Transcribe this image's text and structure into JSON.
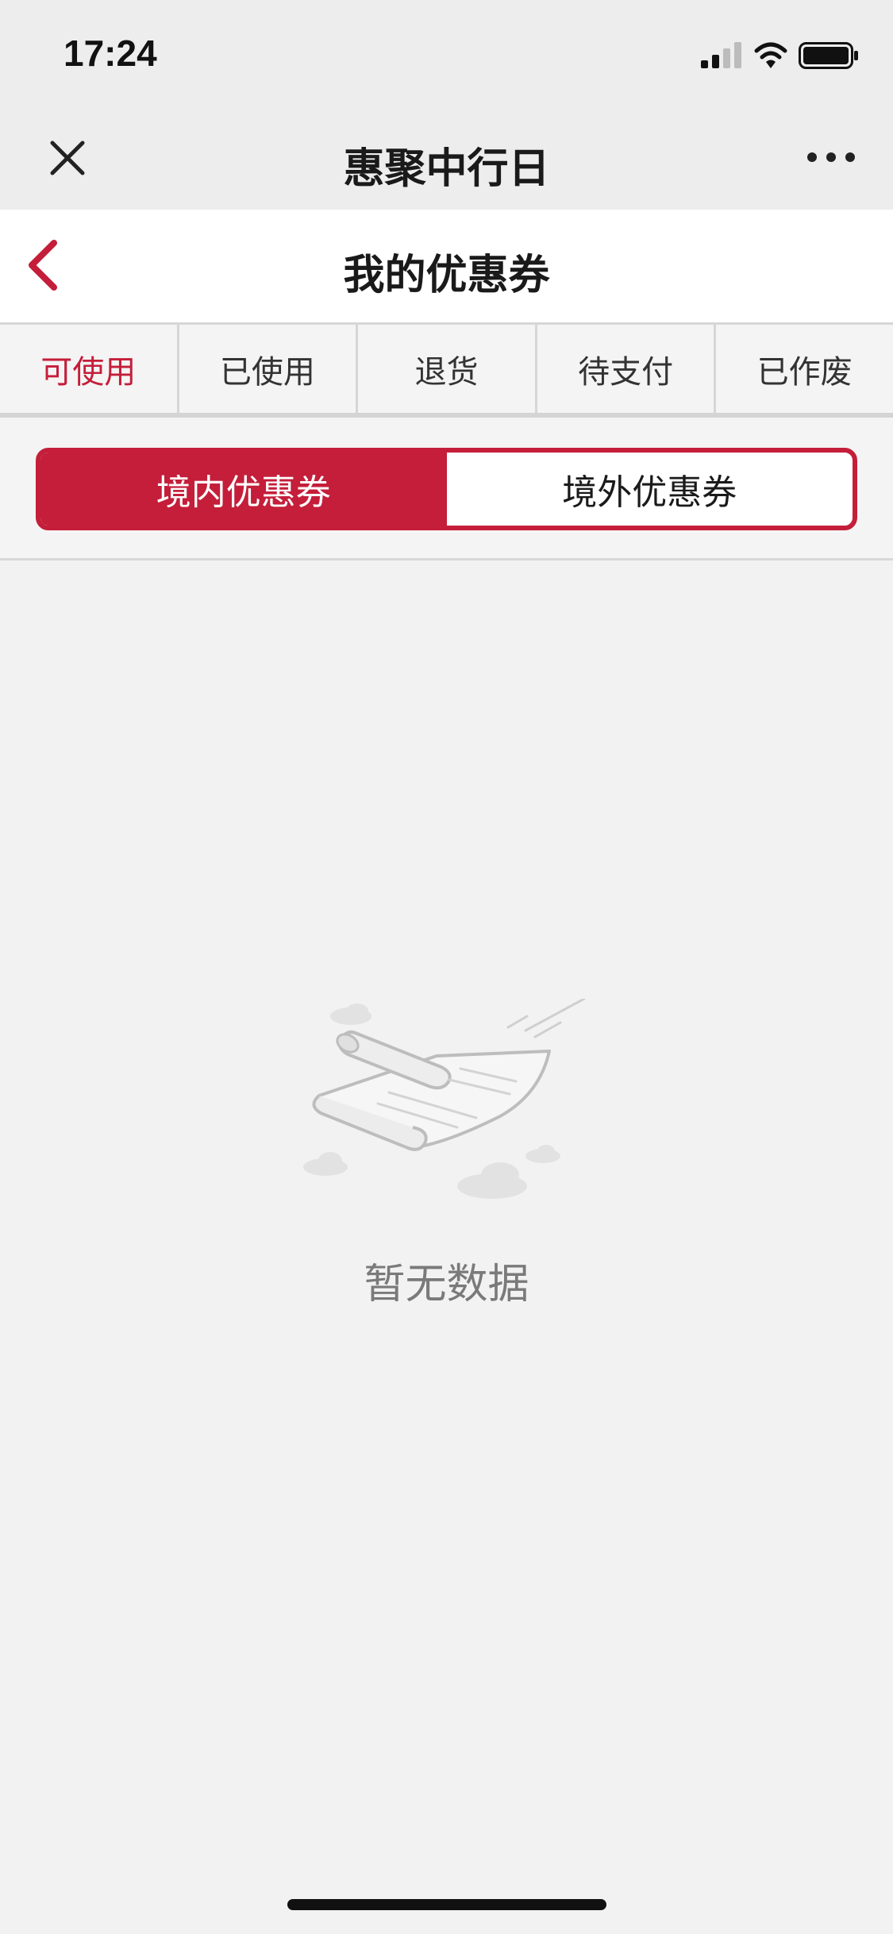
{
  "status_bar": {
    "time": "17:24",
    "icons": [
      "signal-icon",
      "wifi-icon",
      "battery-icon"
    ]
  },
  "wechat_nav": {
    "title": "惠聚中行日",
    "close_icon": "close-icon",
    "more_icon": "more-dots-icon"
  },
  "page_header": {
    "title": "我的优惠券",
    "back_icon": "chevron-left-icon"
  },
  "status_tabs": [
    {
      "label": "可使用",
      "active": true
    },
    {
      "label": "已使用",
      "active": false
    },
    {
      "label": "退货",
      "active": false
    },
    {
      "label": "待支付",
      "active": false
    },
    {
      "label": "已作废",
      "active": false
    }
  ],
  "segment": {
    "options": [
      {
        "label": "境内优惠券",
        "active": true
      },
      {
        "label": "境外优惠券",
        "active": false
      }
    ]
  },
  "empty_state": {
    "text": "暂无数据",
    "icon": "empty-paper-scroll-icon"
  },
  "colors": {
    "accent": "#c41e3a",
    "background": "#f2f2f2",
    "nav_background": "#ededed",
    "header_background": "#ffffff"
  }
}
